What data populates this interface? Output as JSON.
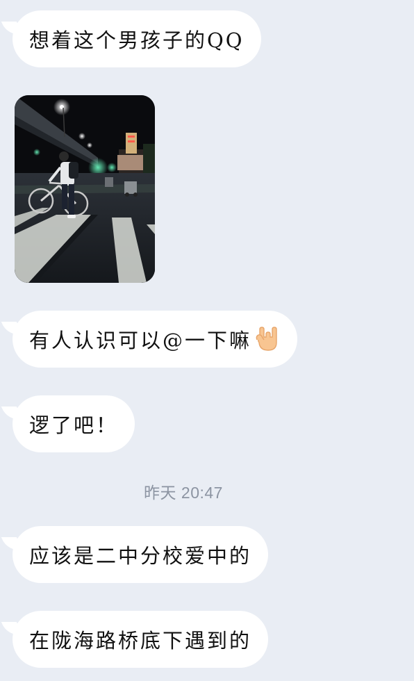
{
  "messages": [
    {
      "text": "想着这个男孩子的QQ"
    },
    {
      "image": "street-photo-cyclist-night"
    },
    {
      "text": "有人认识可以@一下嘛",
      "emoji": "rock-on-hand-icon"
    },
    {
      "text": "逻了吧！"
    },
    {
      "timestamp": "昨天 20:47"
    },
    {
      "text": "应该是二中分校爱中的"
    },
    {
      "text": "在陇海路桥底下遇到的"
    }
  ],
  "colors": {
    "background": "#e9edf4",
    "bubble": "#ffffff",
    "text": "#111111",
    "timestamp": "#8c94a2"
  }
}
